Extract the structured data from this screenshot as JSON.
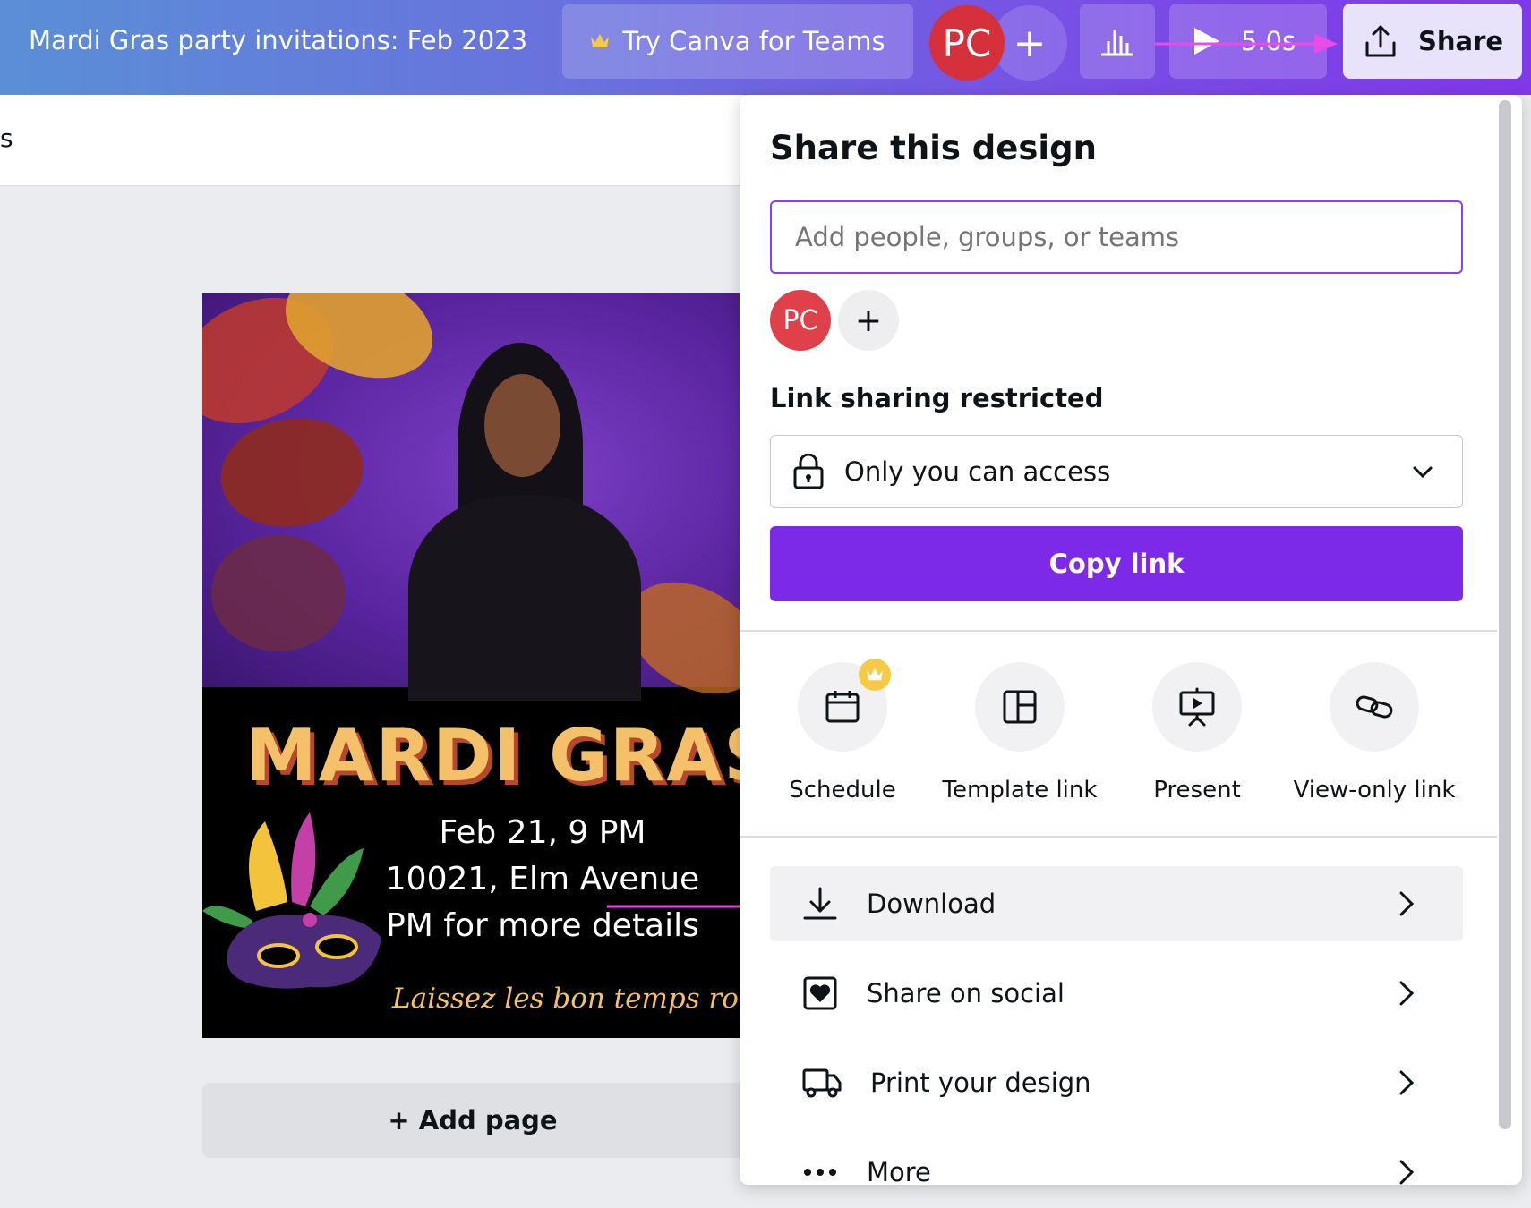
{
  "topbar": {
    "doc_title": "Mardi Gras party invitations: Feb 2023",
    "teams_button": "Try Canva for Teams",
    "avatar_initials": "PC",
    "add_collaborator": "+",
    "play_duration": "5.0s",
    "share_button": "Share"
  },
  "subbar": {
    "stub_text": "s"
  },
  "design": {
    "title": "MARDI GRAS N",
    "date_line": "Feb 21, 9 PM",
    "address_line": "10021, Elm Avenue",
    "details_line": "PM for more details",
    "tagline": "Laissez les bon temps rouler"
  },
  "add_page": "+ Add page",
  "share_panel": {
    "title": "Share this design",
    "people_placeholder": "Add people, groups, or teams",
    "avatar_initials": "PC",
    "add_collaborator": "+",
    "link_label": "Link sharing restricted",
    "access_value": "Only you can access",
    "copy_link": "Copy link",
    "quick_actions": [
      {
        "label": "Schedule",
        "icon": "calendar-icon",
        "premium": true
      },
      {
        "label": "Template link",
        "icon": "template-icon",
        "premium": false
      },
      {
        "label": "Present",
        "icon": "present-icon",
        "premium": false
      },
      {
        "label": "View-only link",
        "icon": "link-icon",
        "premium": false
      }
    ],
    "actions": [
      {
        "label": "Download",
        "icon": "download-icon"
      },
      {
        "label": "Share on social",
        "icon": "heart-icon"
      },
      {
        "label": "Print your design",
        "icon": "truck-icon"
      },
      {
        "label": "More",
        "icon": "more-icon"
      }
    ]
  },
  "colors": {
    "accent": "#7d2ae8",
    "input_border": "#8b3dff",
    "avatar": "#d6303a",
    "annotation_arrow": "#e84be6",
    "title_gold": "#f5c06a"
  }
}
